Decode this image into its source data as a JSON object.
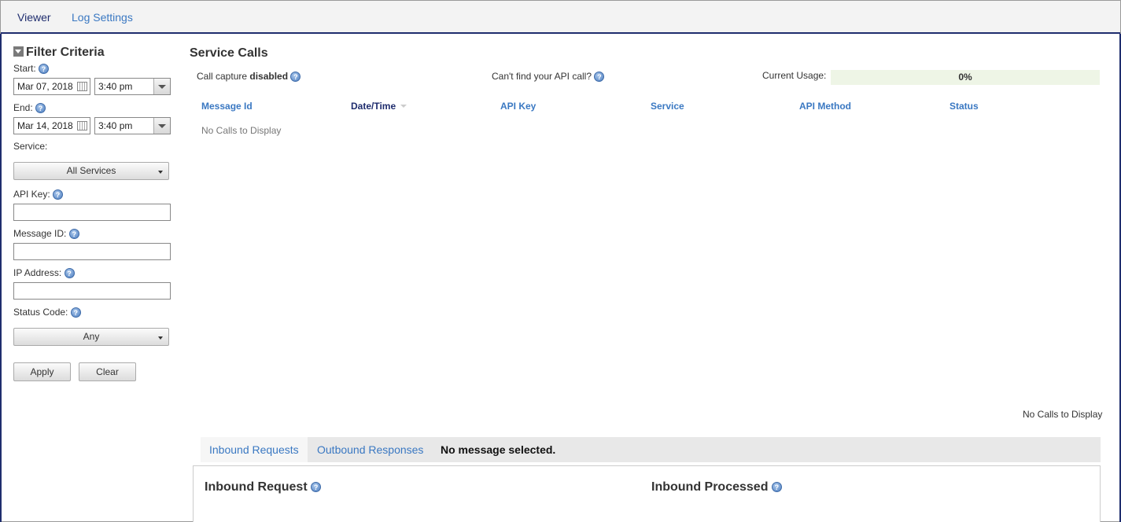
{
  "nav": {
    "tabs": [
      {
        "label": "Viewer"
      },
      {
        "label": "Log Settings"
      }
    ]
  },
  "filter": {
    "title": "Filter Criteria",
    "start_label": "Start:",
    "start_date": "Mar 07, 2018",
    "start_time": "3:40 pm",
    "end_label": "End:",
    "end_date": "Mar 14, 2018",
    "end_time": "3:40 pm",
    "service_label": "Service:",
    "service_value": "All Services",
    "api_key_label": "API Key:",
    "message_id_label": "Message ID:",
    "ip_address_label": "IP Address:",
    "status_code_label": "Status Code:",
    "status_code_value": "Any",
    "apply_label": "Apply",
    "clear_label": "Clear"
  },
  "main": {
    "title": "Service Calls",
    "call_capture_prefix": "Call capture",
    "call_capture_state": "disabled",
    "cant_find": "Can't find your API call?",
    "usage_label": "Current Usage:",
    "usage_value": "0%",
    "columns": [
      "Message Id",
      "Date/Time",
      "API Key",
      "Service",
      "API Method",
      "Status"
    ],
    "empty_text": "No Calls to Display",
    "pager_text": "No Calls to Display"
  },
  "message": {
    "tabs": [
      "Inbound Requests",
      "Outbound Responses"
    ],
    "status": "No message selected.",
    "left_title": "Inbound Request",
    "right_title": "Inbound Processed"
  },
  "colors": {
    "nav_dark": "#1f2d6e",
    "link_blue": "#3a78c2",
    "usage_bg": "#eef5e6"
  },
  "icons": [
    "help-icon",
    "calendar-icon",
    "collapse-triangle-icon",
    "dropdown-arrow-icon"
  ]
}
